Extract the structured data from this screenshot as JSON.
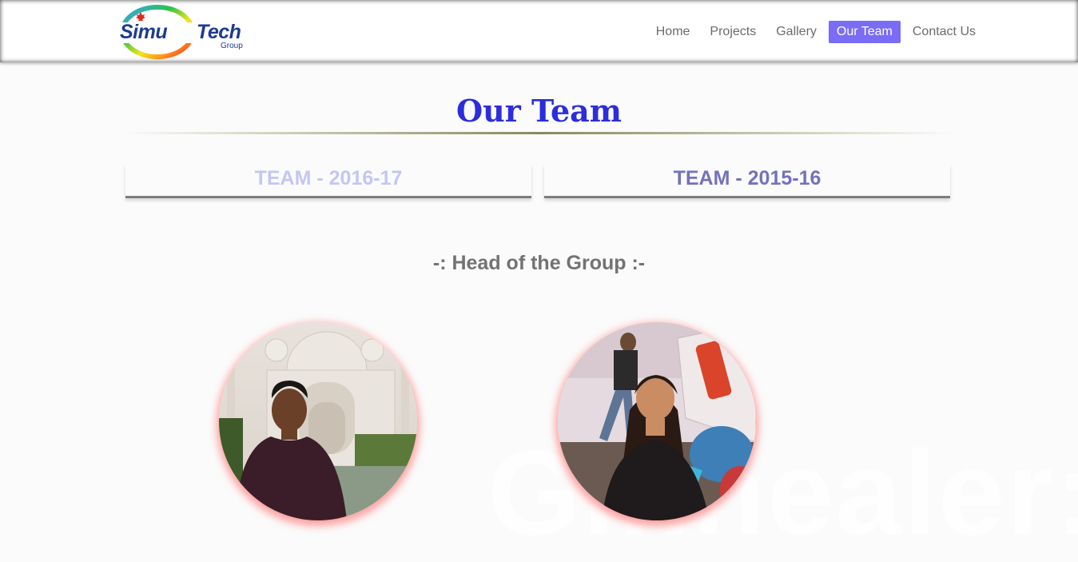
{
  "logo": {
    "part1": "Simu",
    "part2": "Tech",
    "sub": "Group"
  },
  "nav": {
    "items": [
      {
        "label": "Home",
        "active": false
      },
      {
        "label": "Projects",
        "active": false
      },
      {
        "label": "Gallery",
        "active": false
      },
      {
        "label": "Our Team",
        "active": true
      },
      {
        "label": "Contact Us",
        "active": false
      }
    ]
  },
  "page": {
    "title": "Our Team",
    "tabs": [
      {
        "label": "TEAM - 2016-17",
        "selected": false
      },
      {
        "label": "TEAM - 2015-16",
        "selected": true
      }
    ],
    "section_heading": "-: Head of the Group :-"
  },
  "watermark": "Glnnealer:i",
  "colors": {
    "accent": "#7b6cf5",
    "title": "#2c2ddd",
    "tab_active": "#7371bf",
    "tab_inactive": "#c5c6f3",
    "logo_text": "#1d3b8f"
  }
}
